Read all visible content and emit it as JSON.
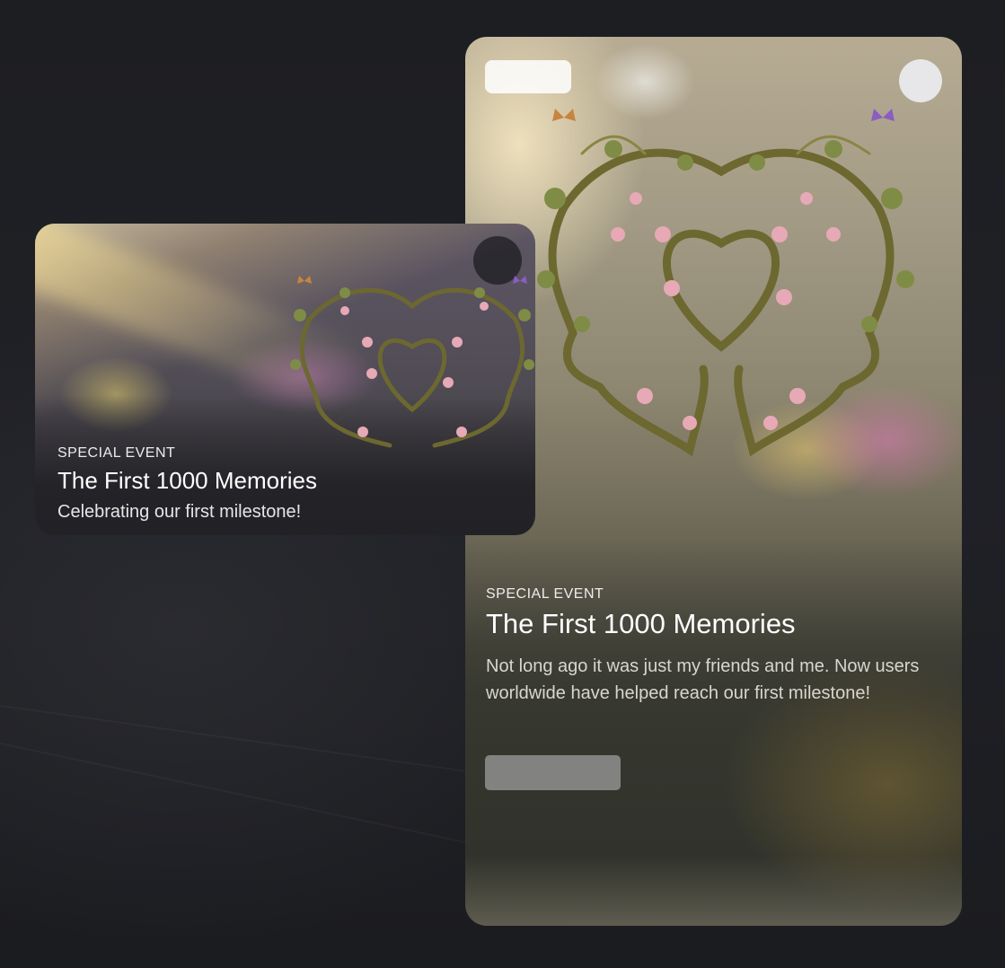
{
  "large_card": {
    "eyebrow": "SPECIAL EVENT",
    "title": "The First 1000 Memories",
    "description": "Not long ago it was just my friends and me. Now users worldwide have helped reach our first milestone!"
  },
  "small_card": {
    "eyebrow": "SPECIAL EVENT",
    "title": "The First 1000 Memories",
    "description": "Celebrating our first milestone!"
  },
  "artwork": {
    "icon": "heart-vine-wreath-icon",
    "vine_color": "#6f6a30",
    "flower_color": "#e8a9b8",
    "butterfly_left_color": "#c8843f",
    "butterfly_right_color": "#8a5cc4"
  }
}
